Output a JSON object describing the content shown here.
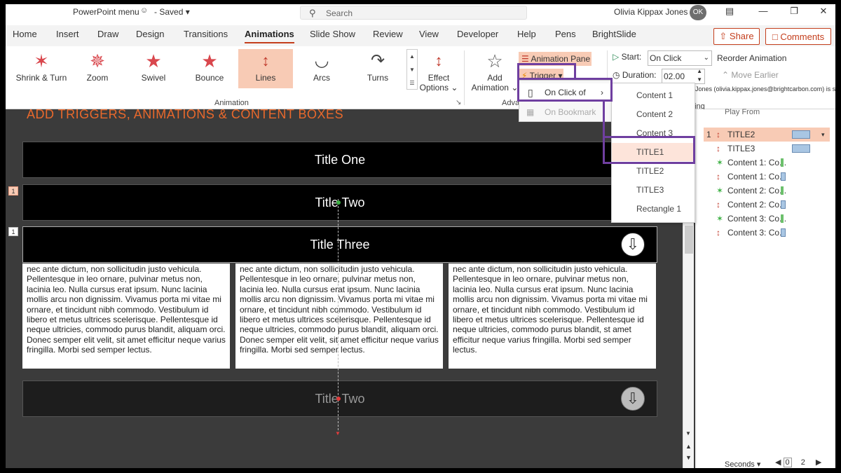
{
  "titlebar": {
    "app_name": "PowerPoint menu",
    "saved_status": "Saved",
    "search_placeholder": "Search",
    "user_name": "Olivia Kippax Jones",
    "user_initials": "OK"
  },
  "tabs": [
    "Home",
    "Insert",
    "Draw",
    "Design",
    "Transitions",
    "Animations",
    "Slide Show",
    "Review",
    "View",
    "Developer",
    "Help",
    "Pens",
    "BrightSlide"
  ],
  "active_tab": "Animations",
  "share_label": "Share",
  "comments_label": "Comments",
  "ribbon": {
    "animations": [
      {
        "label": "Shrink & Turn"
      },
      {
        "label": "Zoom"
      },
      {
        "label": "Swivel"
      },
      {
        "label": "Bounce"
      },
      {
        "label": "Lines"
      },
      {
        "label": "Arcs"
      },
      {
        "label": "Turns"
      }
    ],
    "selected_animation": "Lines",
    "effect_options_line1": "Effect",
    "effect_options_line2": "Options",
    "animation_group_label": "Animation",
    "add_animation_line1": "Add",
    "add_animation_line2": "Animation",
    "advanced_group_label": "Adva",
    "animation_pane_label": "Animation Pane",
    "trigger_label": "Trigger",
    "start_label": "Start:",
    "start_value": "On Click",
    "duration_label": "Duration:",
    "duration_value": "02.00",
    "reorder_label": "Reorder Animation",
    "move_earlier_label": "Move Earlier",
    "timing_fragment": "ning"
  },
  "trigger_menu": {
    "on_click_of": "On Click of",
    "on_bookmark": "On Bookmark"
  },
  "trigger_submenu": [
    "Content 1",
    "Content 2",
    "Content 3",
    "TITLE1",
    "TITLE2",
    "TITLE3",
    "Rectangle 1"
  ],
  "trigger_submenu_selected": "TITLE1",
  "slide": {
    "heading": "ADD TRIGGERS, ANIMATIONS & CONTENT BOXES",
    "title_one": "Title One",
    "title_two": "Title Two",
    "title_three": "Title Three",
    "title_two_bottom": "Title Two",
    "tag_one": "1",
    "body_text": "nec ante dictum, non sollicitudin justo vehicula. Pellentesque in leo ornare, pulvinar metus non, lacinia leo. Nulla cursus erat ipsum. Nunc lacinia mollis arcu non dignissim. Vivamus porta mi vitae mi ornare, et tincidunt nibh commodo. Vestibulum id libero et metus ultrices scelerisque. Pellentesque id neque ultricies, commodo purus blandit, aliquam orci. Donec semper elit velit, sit amet efficitur neque varius fringilla. Morbi sed semper lectus.",
    "body_text_3": "nec ante dictum, non sollicitudin justo vehicula. Pellentesque in leo ornare, pulvinar metus non, lacinia leo. Nulla cursus erat ipsum. Nunc lacinia mollis arcu non dignissim. Vivamus porta mi vitae mi ornare, et tincidunt nibh commodo. Vestibulum id libero et metus ultrices scelerisque. Pellentesque id neque ultricies, commodo purus blandit, st amet efficitur neque varius fringilla. Morbi sed semper lectus."
  },
  "animation_pane": {
    "tooltip": "Jones (olivia.kippax.jones@brightcarbon.com) is signed in",
    "play_from": "Play From",
    "items": [
      {
        "num": "1",
        "name": "TITLE2",
        "type": "line"
      },
      {
        "num": "",
        "name": "TITLE3",
        "type": "line"
      },
      {
        "num": "",
        "name": "Content 1: Co...",
        "type": "star"
      },
      {
        "num": "",
        "name": "Content 1: Co...",
        "type": "line"
      },
      {
        "num": "",
        "name": "Content 2: Co...",
        "type": "star"
      },
      {
        "num": "",
        "name": "Content 2: Co...",
        "type": "line"
      },
      {
        "num": "",
        "name": "Content 3: Co...",
        "type": "star"
      },
      {
        "num": "",
        "name": "Content 3: Co...",
        "type": "line"
      }
    ],
    "seconds_label": "Seconds",
    "zoom_start": "0",
    "zoom_end": "2"
  },
  "colors": {
    "accent": "#c43e1c",
    "selection": "#f8cbb5",
    "highlight_box": "#6f3fa0",
    "slide_heading": "#e9692c"
  }
}
